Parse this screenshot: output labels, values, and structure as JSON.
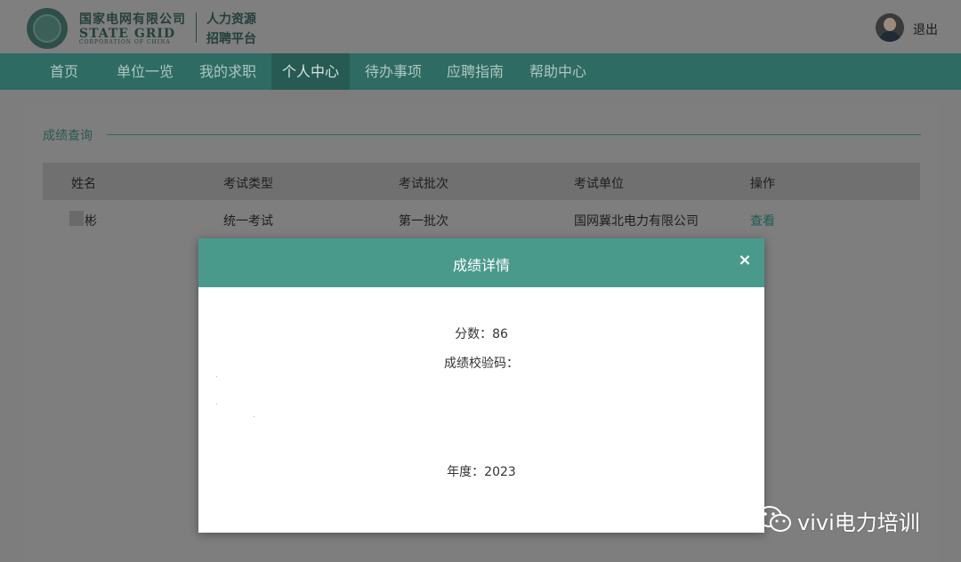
{
  "header": {
    "org_cn": "国家电网有限公司",
    "org_en": "STATE GRID",
    "org_en_sub": "CORPORATION OF CHINA",
    "platform_line1": "人力资源",
    "platform_line2": "招聘平台",
    "logout_label": "退出"
  },
  "nav": {
    "items": [
      {
        "label": "首页"
      },
      {
        "label": "单位一览"
      },
      {
        "label": "我的求职"
      },
      {
        "label": "个人中心",
        "active": true
      },
      {
        "label": "待办事项"
      },
      {
        "label": "应聘指南"
      },
      {
        "label": "帮助中心"
      }
    ]
  },
  "section": {
    "title": "成绩查询"
  },
  "table": {
    "headers": [
      "姓名",
      "考试类型",
      "考试批次",
      "考试单位",
      "操作"
    ],
    "rows": [
      {
        "name": "彬",
        "exam_type": "统一考试",
        "batch": "第一批次",
        "unit": "国网冀北电力有限公司",
        "action": "查看"
      }
    ]
  },
  "modal": {
    "title": "成绩详情",
    "close_label": "×",
    "score": "分数：86",
    "verify_code": "成绩校验码：",
    "year": "年度：2023"
  },
  "watermark": {
    "text": "vivi电力培训"
  },
  "colors": {
    "nav_bg": "#2e6b62",
    "modal_header": "#4a9a8c",
    "overlay_bg": "#7d7d7d"
  }
}
